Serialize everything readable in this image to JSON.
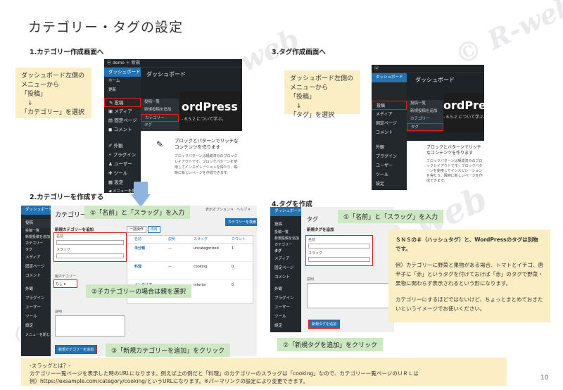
{
  "page": {
    "title": "カテゴリー・タグの設定",
    "page_number": "10",
    "watermark": "© R-web"
  },
  "section1": {
    "heading": "1.カテゴリー作成画面へ",
    "callout": "ダッシュボード左側の\nメニューから\n「投稿」\n　↓\n「カテゴリー」を選択"
  },
  "section2": {
    "heading": "2.カテゴリーを作成する",
    "step1": "①「名前」と「スラッグ」を入力",
    "step2": "②子カテゴリーの場合は親を選択",
    "step3": "③「新規カテゴリーを追加」をクリック"
  },
  "section3": {
    "heading": "3.タグ作成画面へ",
    "callout": "ダッシュボード左側の\nメニューから\n「投稿」\n　↓\n「タグ」を選択"
  },
  "section4": {
    "heading": "4.タグを作成",
    "step1": "①「名前」と「スラッグ」を入力",
    "step2": "②「新規タグを追加」をクリック"
  },
  "note": {
    "text": "ＳＮＳの＃（ハッシュタグ）と、WordPressのタグは別物です。",
    "text2": "例）カテゴリーに野菜と果物がある場合、トマトとイチゴ、唐辛子に「赤」というタグを付けておけば「赤」のタグで野菜・果物に関わらず表示されるという形になります。",
    "text3": "カテゴリーにするほどではないけど、ちょっとまとめておきたいというイメージでお使いください。"
  },
  "footer": {
    "line1": "-スラッグとは？-",
    "line2": "カテゴリー一覧ページを表示した時のURLになります。例えば上の例だと「料理」のカテゴリーのスラッグは「cooking」なので、カテゴリー一覧ページのＵＲＬは",
    "line3": "例）https://exsample.com/category/cooking/というURLになります。※パーマリンクの設定により変更できます。"
  },
  "wp": {
    "site_name": "demo",
    "new_label": "＋ 新規",
    "dashboard": "ダッシュボード",
    "home": "ホーム",
    "updates": "更新",
    "posts": "投稿",
    "media": "メディア",
    "pages": "固定ページ",
    "comments": "コメント",
    "appearance": "外観",
    "plugins": "プラグイン",
    "users": "ユーザー",
    "tools": "ツール",
    "settings": "設定",
    "collapse": "メニューを閉じる",
    "fly_all": "投稿一覧",
    "fly_new": "新規投稿を追加",
    "fly_cat": "カテゴリー",
    "fly_tag": "タグ",
    "hero_text": "ordPress へよ",
    "hero_sub": "- 6.5.2 について学ぶ。",
    "hero_text_tag": "ordPress",
    "block_title": "ブロックとパターンでリッチなコンテンツを作ります",
    "block_desc": "ブロックパターンは構成済みのブロックレイアウトです。ブロックパターンを使用してインスピレーションを得たり、瞬時に新しいページを作成できます。",
    "category_page": "カテゴリー",
    "tag_page": "タグ",
    "add_cat_title": "新規カテゴリーを追加",
    "add_tag_title": "新規タグを追加",
    "name_label": "名前",
    "slug_label": "スラッグ",
    "parent_label": "親カテゴリー",
    "parent_value": "なし",
    "desc_label": "説明",
    "add_cat_btn": "新規カテゴリーを追加",
    "add_tag_btn": "新規タグを追加",
    "search_btn": "カテゴリーを検索",
    "bulk": "一括操作",
    "apply": "適用",
    "display_options": "表示オプション",
    "help": "ヘルプ",
    "col_name": "名前",
    "col_desc": "説明",
    "col_slug": "スラッグ",
    "col_count": "カウント",
    "rows": [
      {
        "name": "未分類",
        "desc": "—",
        "slug": "uncategorized",
        "count": "1"
      },
      {
        "name": "料理",
        "desc": "—",
        "slug": "cooking",
        "count": "0"
      },
      {
        "name": "インテリア",
        "desc": "—",
        "slug": "interior",
        "count": "0"
      }
    ]
  },
  "colors": {
    "callout": "#fbeec4",
    "green_tag": "#cfe8c4",
    "wp_dark": "#1d2327",
    "wp_blue": "#2271b1",
    "highlight": "#e02020"
  }
}
